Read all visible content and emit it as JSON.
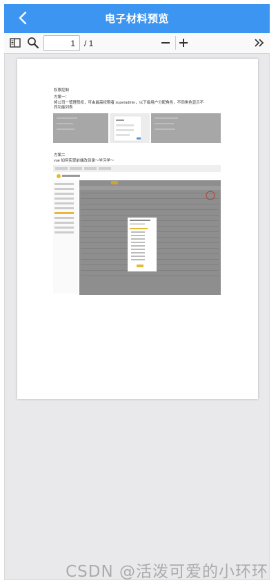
{
  "header": {
    "title": "电子材料预览",
    "color": "#3d95f2"
  },
  "toolbar": {
    "sidebar_icon": "sidebar-toggle-icon",
    "search_icon": "search-icon",
    "page_number": "1",
    "page_total": "/ 1",
    "zoom_out_icon": "minus-icon",
    "zoom_in_icon": "plus-icon",
    "more_icon": "double-chevron-right-icon"
  },
  "document": {
    "heading": "权限控制",
    "plan_one_title": "方案一：",
    "plan_one_text": "将公司一管理员权，可由最高权限者 superadmin，以下级用户分配角色，不同角色显示不",
    "plan_one_text_2": "同功能列表",
    "plan_two_title": "方案二",
    "plan_two_text": "vue 如何实现前端改目录～学习学～"
  },
  "watermark": "CSDN @活泼可爱的小环环"
}
